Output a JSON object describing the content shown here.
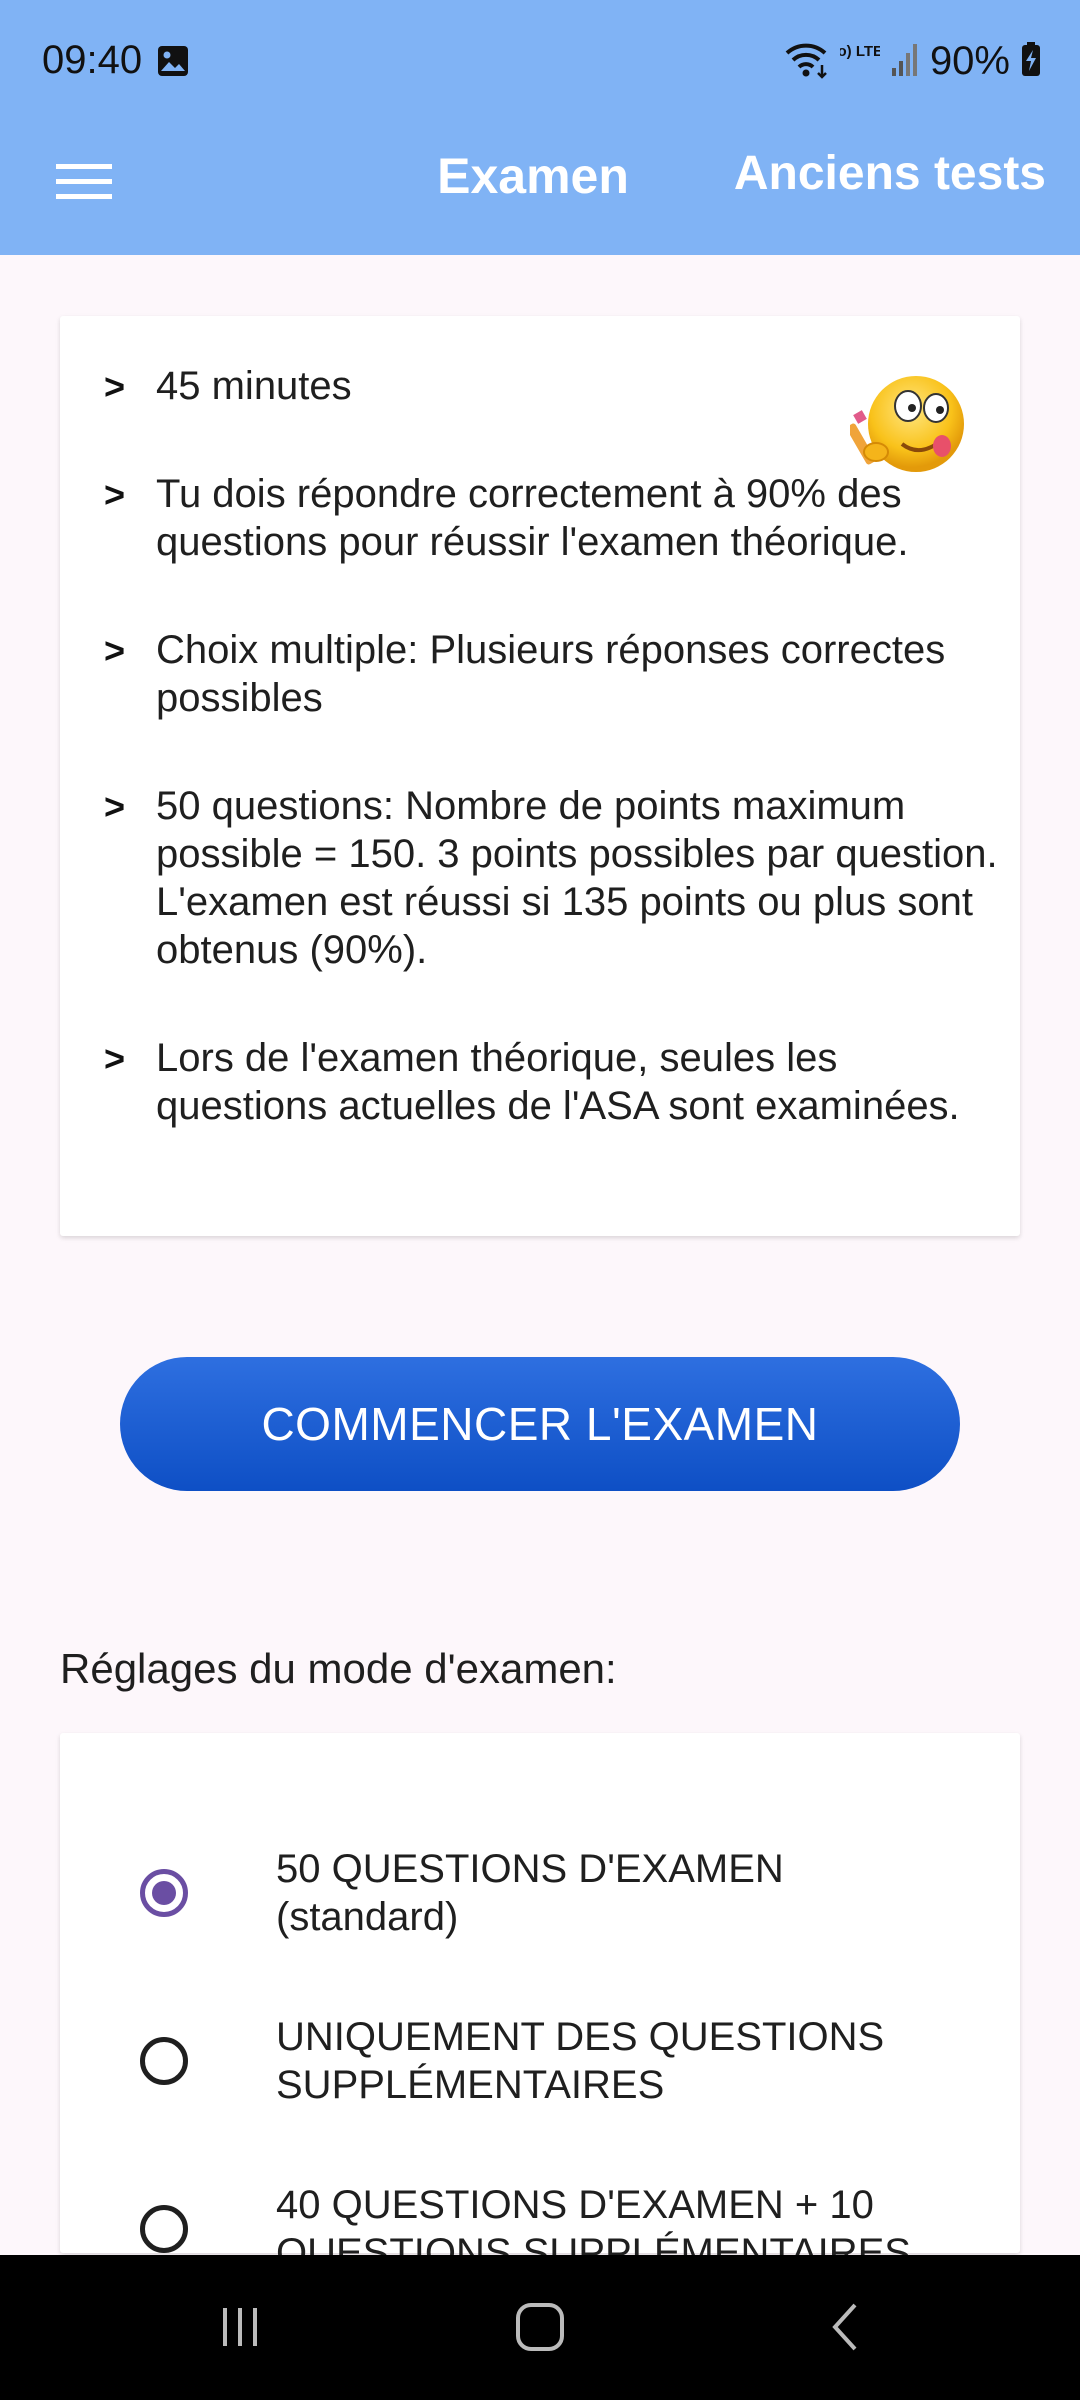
{
  "status_bar": {
    "time": "09:40",
    "battery": "90%",
    "network_label": "Vo) LTE1",
    "icons": [
      "gallery-icon",
      "wifi-icon",
      "volte-icon",
      "signal-icon",
      "battery-charging-icon"
    ]
  },
  "app_bar": {
    "menu_icon": "hamburger-menu-icon",
    "title": "Examen",
    "action_label": "Anciens tests"
  },
  "info": {
    "bullet": ">",
    "items": [
      "45 minutes",
      "Tu dois répondre correctement à 90% des questions pour réussir l'examen théorique.",
      "Choix multiple: Plusieurs réponses correctes possibles",
      "50 questions: Nombre de points maximum possible = 150. 3 points possibles par question. L'examen est réussi si 135 points ou plus sont obtenus (90%).",
      "Lors de l'examen théorique, seules les questions actuelles de l'ASA sont examinées."
    ],
    "emoji_icon": "thinking-face-pencil-icon"
  },
  "start_button_label": "COMMENCER L'EXAMEN",
  "settings": {
    "label": "Réglages du mode d'examen:",
    "selected_index": 0,
    "options": [
      {
        "label_line1": "50 QUESTIONS D'EXAMEN",
        "label_line2": "(standard)"
      },
      {
        "label_line1": "UNIQUEMENT DES QUESTIONS",
        "label_line2": "SUPPLÉMENTAIRES"
      },
      {
        "label_line1": "40 QUESTIONS D'EXAMEN + 10",
        "label_line2": "QUESTIONS SUPPLÉMENTAIRES"
      }
    ]
  },
  "nav_bar": {
    "icons": [
      "recent-apps-icon",
      "home-icon",
      "back-icon"
    ]
  },
  "colors": {
    "app_bar": "#80b3f5",
    "primary_button": "#1558d6",
    "radio_selected": "#6a4ea3",
    "background": "#fdf7fb"
  }
}
